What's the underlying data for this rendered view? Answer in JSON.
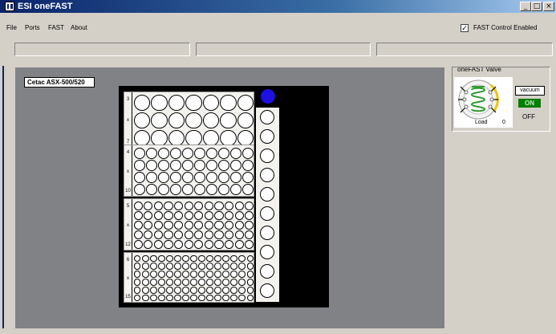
{
  "window": {
    "title": "ESI oneFAST"
  },
  "titlebar_buttons": {
    "minimize": "_",
    "maximize": "□",
    "close": "×"
  },
  "menu": {
    "items": [
      "File",
      "Ports",
      "FAST",
      "About"
    ]
  },
  "fast_control": {
    "label": "FAST Control Enabled",
    "checked": true,
    "check_glyph": "✓"
  },
  "autosampler": {
    "label": "Cetac ASX-500/520",
    "racks": [
      {
        "labels": [
          "3",
          "x",
          "7"
        ],
        "rows": 3,
        "cols": 7
      },
      {
        "labels": [
          "4",
          "x",
          "10"
        ],
        "rows": 4,
        "cols": 10
      },
      {
        "labels": [
          "5",
          "x",
          "12"
        ],
        "rows": 5,
        "cols": 12
      },
      {
        "labels": [
          "6",
          "x",
          "15"
        ],
        "rows": 6,
        "cols": 15
      }
    ],
    "rinse_positions": 10,
    "probe_color": "#1e10e0"
  },
  "valve": {
    "title": "oneFAST Valve",
    "position_label": "Load",
    "position_value": "0",
    "vacuum_label": "vacuum",
    "on_label": "ON",
    "off_label": "OFF",
    "coil_color": "#2e9b2e"
  }
}
